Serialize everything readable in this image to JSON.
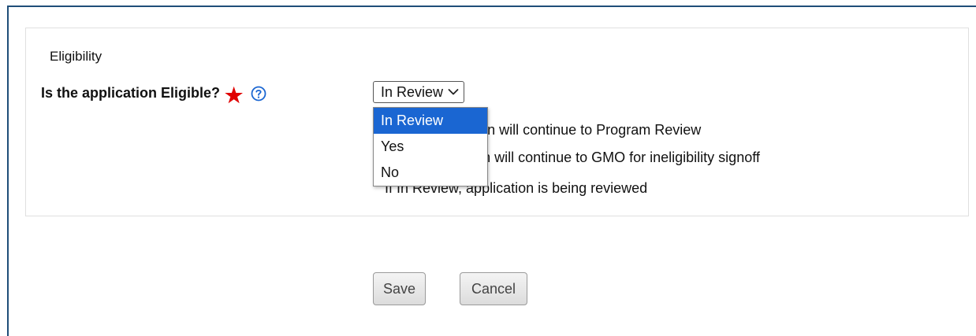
{
  "section": {
    "title": "Eligibility"
  },
  "question": {
    "label": "Is the application Eligible?",
    "required_marker": "★",
    "help_icon": "question-circle-icon"
  },
  "select": {
    "value": "In Review",
    "options": [
      "In Review",
      "Yes",
      "No"
    ],
    "selected_index": 0
  },
  "explanations": {
    "line1": "If Yes, application will continue to Program Review",
    "line2": "If No, application will continue to GMO for ineligibility signoff",
    "line3": "If In Review, application is being reviewed"
  },
  "buttons": {
    "save": "Save",
    "cancel": "Cancel"
  },
  "colors": {
    "frame_border": "#1f4e79",
    "required": "#e00000",
    "help_icon": "#1a66d2",
    "selected_option": "#1a66d2"
  }
}
